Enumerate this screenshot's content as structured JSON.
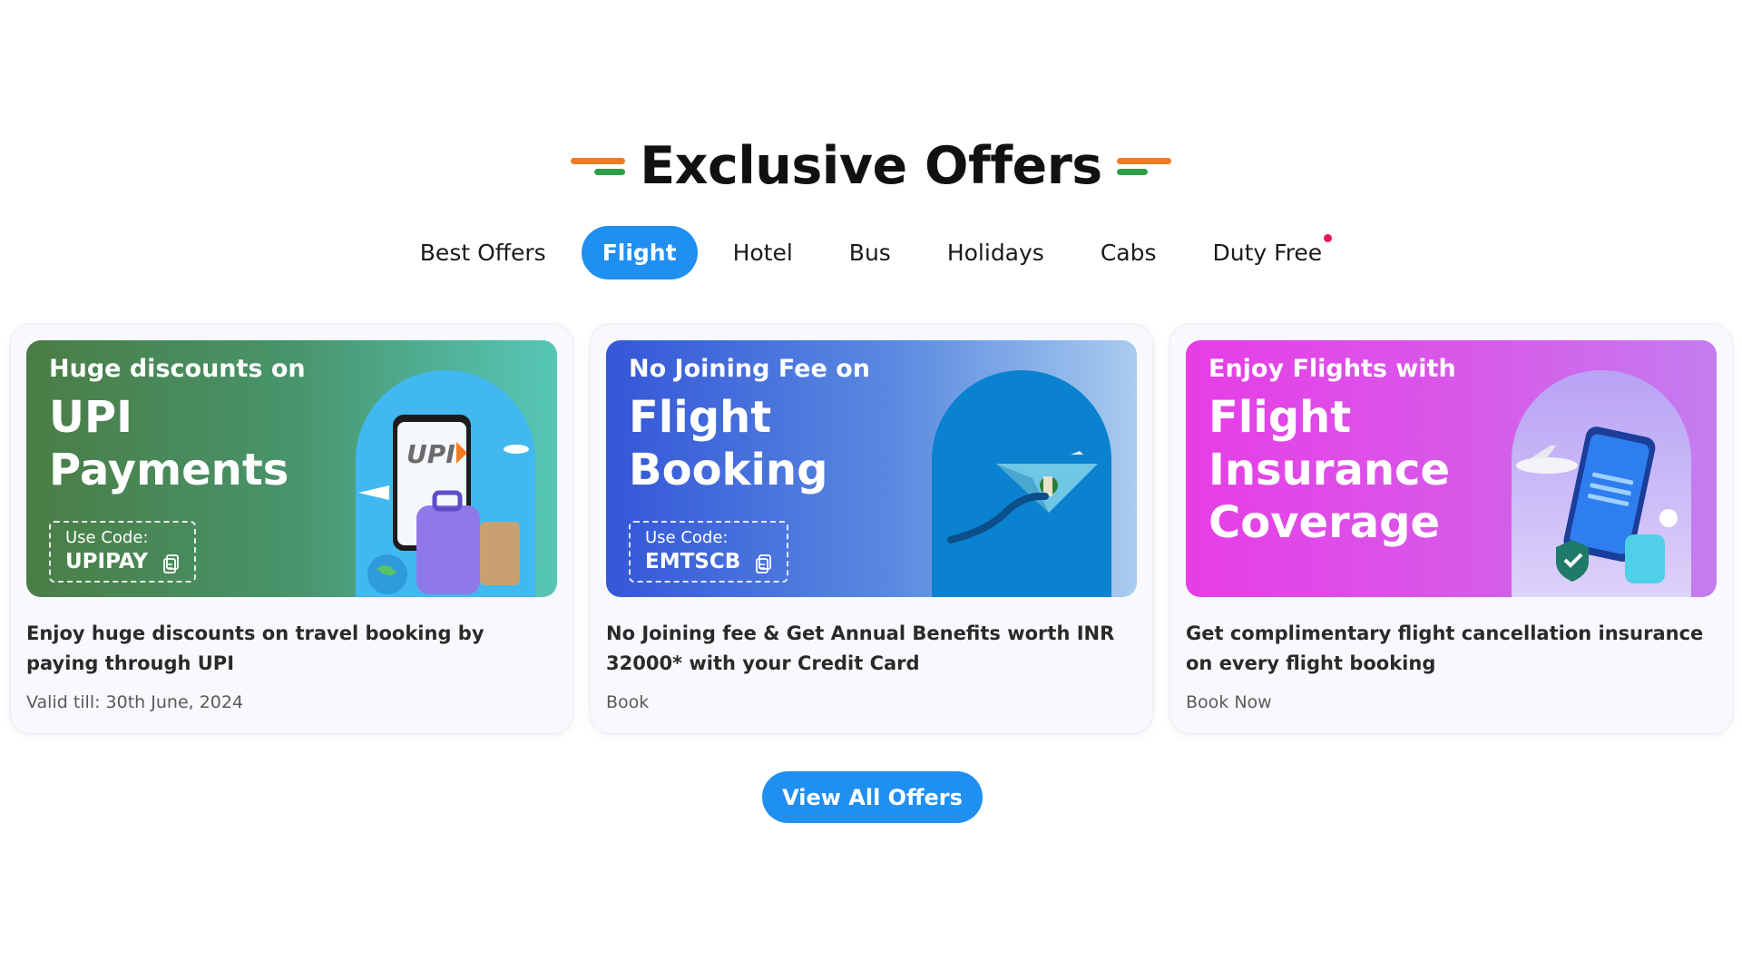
{
  "section": {
    "title": "Exclusive Offers"
  },
  "tabs": [
    {
      "label": "Best Offers",
      "active": false
    },
    {
      "label": "Flight",
      "active": true
    },
    {
      "label": "Hotel",
      "active": false
    },
    {
      "label": "Bus",
      "active": false
    },
    {
      "label": "Holidays",
      "active": false
    },
    {
      "label": "Cabs",
      "active": false
    },
    {
      "label": "Duty Free",
      "active": false,
      "has_notification_dot": true
    }
  ],
  "cards": [
    {
      "kicker": "Huge discounts on",
      "headline_lines": [
        "UPI",
        "Payments"
      ],
      "code_label": "Use Code:",
      "code": "UPIPAY",
      "illustration_text": "UPI",
      "description": "Enjoy huge discounts on travel booking by paying through UPI",
      "meta": "Valid till: 30th June, 2024",
      "theme_color": "#4a7d45"
    },
    {
      "kicker": "No Joining Fee on",
      "headline_lines": [
        "Flight",
        "Booking"
      ],
      "code_label": "Use Code:",
      "code": "EMTSCB",
      "description": "No Joining fee & Get Annual Benefits worth INR 32000* with your Credit Card",
      "meta": "Book",
      "theme_color": "#3457d8"
    },
    {
      "kicker": "Enjoy Flights with",
      "headline_lines": [
        "Flight",
        "Insurance",
        "Coverage"
      ],
      "description": "Get complimentary flight cancellation insurance on every flight booking",
      "meta": "Book Now",
      "theme_color": "#e73de7"
    }
  ],
  "view_all_label": "View All Offers",
  "colors": {
    "accent_blue": "#1f8ff0",
    "notification_dot": "#e8175d",
    "flag_orange": "#f47a20",
    "flag_green": "#2f9e44"
  }
}
